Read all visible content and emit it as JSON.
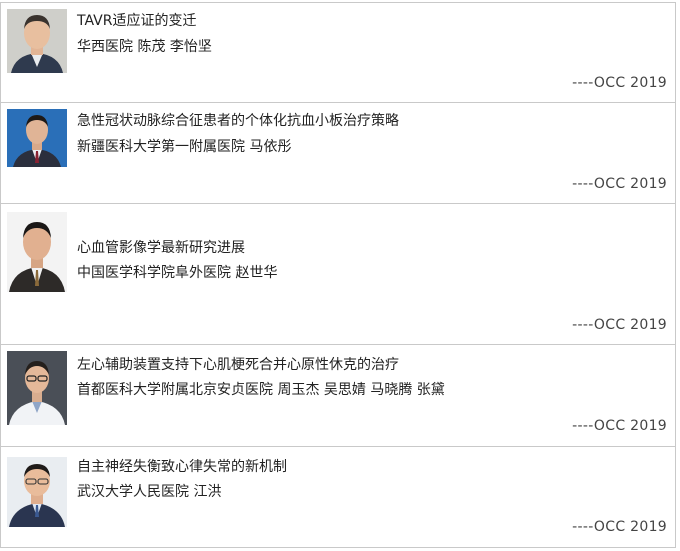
{
  "articles": [
    {
      "title": "TAVR适应证的变迁",
      "authors": " 华西医院 陈茂 李怡坚",
      "source": "----OCC 2019",
      "photo_icon": "doctor-portrait-icon"
    },
    {
      "title": "急性冠状动脉综合征患者的个体化抗血小板治疗策略",
      "authors": " 新疆医科大学第一附属医院 马依彤",
      "source": "----OCC 2019",
      "photo_icon": "doctor-portrait-icon"
    },
    {
      "title": "心血管影像学最新研究进展",
      "authors": "中国医学科学院阜外医院 赵世华",
      "source": "----OCC 2019",
      "photo_icon": "doctor-portrait-icon"
    },
    {
      "title": "左心辅助装置支持下心肌梗死合并心原性休克的治疗",
      "authors": "首都医科大学附属北京安贞医院 周玉杰  吴思婧  马晓腾  张黛",
      "source": "----OCC 2019",
      "photo_icon": "doctor-portrait-icon"
    },
    {
      "title": "自主神经失衡致心律失常的新机制",
      "authors": " 武汉大学人民医院 江洪",
      "source": "----OCC 2019",
      "photo_icon": "doctor-portrait-icon"
    }
  ]
}
